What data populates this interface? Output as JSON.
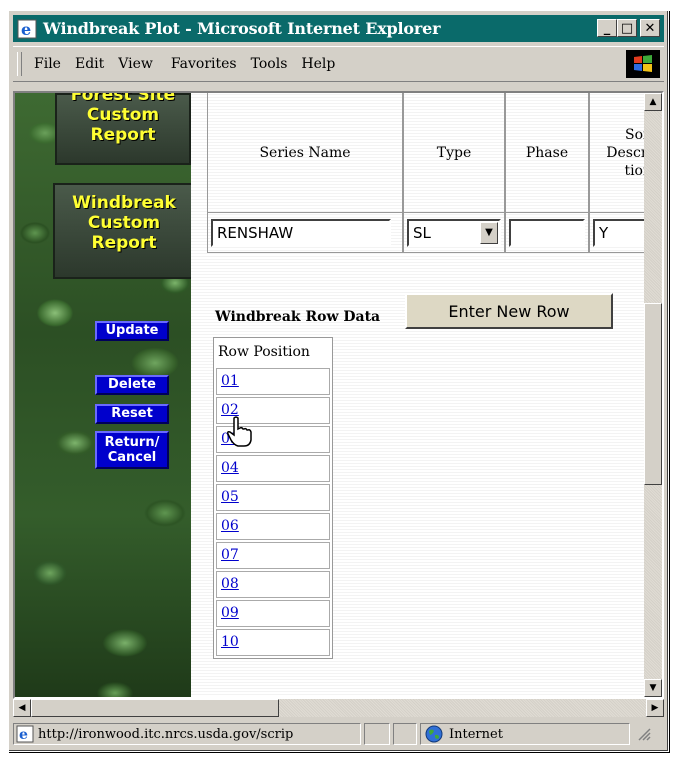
{
  "window": {
    "title": "Windbreak Plot - Microsoft Internet Explorer",
    "controls": {
      "minimize": "_",
      "maximize": "□",
      "close": "✕"
    }
  },
  "menu": [
    "File",
    "Edit",
    "View",
    "Favorites",
    "Tools",
    "Help"
  ],
  "sidebar": {
    "forest_report": [
      "Forest Site",
      "Custom",
      "Report"
    ],
    "windbreak_report": [
      "Windbreak",
      "Custom",
      "Report"
    ],
    "buttons": {
      "update": "Update",
      "delete": "Delete",
      "reset": "Reset",
      "return_cancel": [
        "Return/",
        "Cancel"
      ]
    }
  },
  "soil_table": {
    "headers": [
      "Series Name",
      "Type",
      "Phase",
      "Soil Description"
    ],
    "header_soil_lines": [
      "Soil",
      "Descri",
      "tion"
    ],
    "values": {
      "series_name": "RENSHAW",
      "type": "SL",
      "phase": "",
      "soil_description": "Y"
    }
  },
  "windbreak": {
    "section_label": "Windbreak Row Data",
    "enter_button": "Enter New Row",
    "column_header": "Row Position",
    "rows": [
      "01",
      "02",
      "03",
      "04",
      "05",
      "06",
      "07",
      "08",
      "09",
      "10"
    ]
  },
  "status": {
    "url": "http://ironwood.itc.nrcs.usda.gov/scrip",
    "zone": "Internet"
  },
  "icons": [
    "ie-icon",
    "windows-logo-icon",
    "scroll-up-icon",
    "scroll-down-icon",
    "scroll-left-icon",
    "scroll-right-icon",
    "hand-cursor-icon",
    "globe-icon",
    "resize-grip-icon"
  ]
}
